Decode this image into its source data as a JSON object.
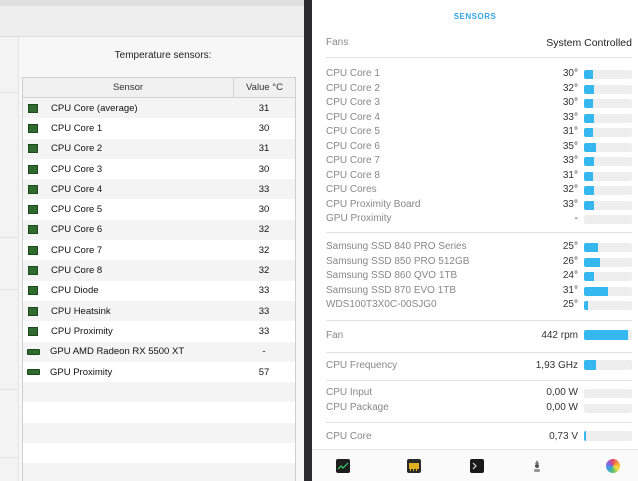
{
  "left": {
    "title": "Temperature sensors:",
    "columns": [
      "Sensor",
      "Value °C"
    ],
    "rows": [
      {
        "name": "CPU Core (average)",
        "value": "31",
        "icon": "cpu-chip-icon"
      },
      {
        "name": "CPU Core 1",
        "value": "30",
        "icon": "cpu-chip-icon"
      },
      {
        "name": "CPU Core 2",
        "value": "31",
        "icon": "cpu-chip-icon"
      },
      {
        "name": "CPU Core 3",
        "value": "30",
        "icon": "cpu-chip-icon"
      },
      {
        "name": "CPU Core 4",
        "value": "33",
        "icon": "cpu-chip-icon"
      },
      {
        "name": "CPU Core 5",
        "value": "30",
        "icon": "cpu-chip-icon"
      },
      {
        "name": "CPU Core 6",
        "value": "32",
        "icon": "cpu-chip-icon"
      },
      {
        "name": "CPU Core 7",
        "value": "32",
        "icon": "cpu-chip-icon"
      },
      {
        "name": "CPU Core 8",
        "value": "32",
        "icon": "cpu-chip-icon"
      },
      {
        "name": "CPU Diode",
        "value": "33",
        "icon": "cpu-chip-icon"
      },
      {
        "name": "CPU Heatsink",
        "value": "33",
        "icon": "cpu-chip-icon"
      },
      {
        "name": "CPU Proximity",
        "value": "33",
        "icon": "cpu-chip-icon"
      },
      {
        "name": "GPU AMD Radeon RX 5500 XT",
        "value": "-",
        "icon": "gpu-card-icon"
      },
      {
        "name": "GPU Proximity",
        "value": "57",
        "icon": "gpu-card-icon"
      }
    ]
  },
  "right": {
    "header": "SENSORS",
    "fans_label": "Fans",
    "fans_status": "System Controlled",
    "cpu_temps": [
      {
        "label": "CPU Core 1",
        "value": "30°",
        "level": 0.18
      },
      {
        "label": "CPU Core 2",
        "value": "32°",
        "level": 0.2
      },
      {
        "label": "CPU Core 3",
        "value": "30°",
        "level": 0.18
      },
      {
        "label": "CPU Core 4",
        "value": "33°",
        "level": 0.2
      },
      {
        "label": "CPU Core 5",
        "value": "31°",
        "level": 0.19
      },
      {
        "label": "CPU Core 6",
        "value": "35°",
        "level": 0.26
      },
      {
        "label": "CPU Core 7",
        "value": "33°",
        "level": 0.2
      },
      {
        "label": "CPU Core 8",
        "value": "31°",
        "level": 0.19
      },
      {
        "label": "CPU Cores",
        "value": "32°",
        "level": 0.2
      },
      {
        "label": "CPU Proximity Board",
        "value": "33°",
        "level": 0.2
      },
      {
        "label": "GPU Proximity",
        "value": "-",
        "level": 0
      }
    ],
    "ssd_temps": [
      {
        "label": "Samsung SSD 840 PRO Series",
        "value": "25°",
        "level": 0.3
      },
      {
        "label": "Samsung SSD 850 PRO 512GB",
        "value": "26°",
        "level": 0.33
      },
      {
        "label": "Samsung SSD 860 QVO 1TB",
        "value": "24°",
        "level": 0.2
      },
      {
        "label": "Samsung SSD 870 EVO 1TB",
        "value": "31°",
        "level": 0.5
      },
      {
        "label": "WDS100T3X0C-00SJG0",
        "value": "25°",
        "level": 0.08
      }
    ],
    "fan": {
      "label": "Fan",
      "value": "442 rpm",
      "level": 0.92
    },
    "cpu_freq": {
      "label": "CPU Frequency",
      "value": "1,93 GHz",
      "level": 0.25
    },
    "power": [
      {
        "label": "CPU Input",
        "value": "0,00 W",
        "level": 0
      },
      {
        "label": "CPU Package",
        "value": "0,00 W",
        "level": 0
      }
    ],
    "cpu_core_v": {
      "label": "CPU Core",
      "value": "0,73 V",
      "level": 0.05
    },
    "bottom_icons": [
      "cpu-monitor-icon",
      "memory-icon",
      "terminal-icon",
      "fan-icon",
      "color-wheel-icon"
    ]
  }
}
